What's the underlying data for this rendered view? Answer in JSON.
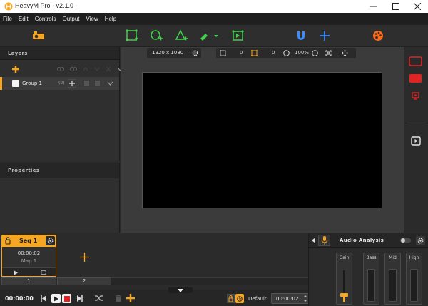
{
  "window": {
    "title": "HeavyM Pro - v2.1.0 -",
    "accent": "#f5a623"
  },
  "menu": [
    "File",
    "Edit",
    "Controls",
    "Output",
    "View",
    "Help"
  ],
  "toolbar": {
    "icons": [
      "settings-heavym-icon",
      "rectangle-shape-icon",
      "circle-shape-icon",
      "triangle-shape-icon",
      "paint-brush-icon",
      "duplicate-shape-icon",
      "magnet-icon",
      "crosshair-icon",
      "palette-icon"
    ],
    "colors": {
      "shape": "#41d14a",
      "magnet": "#3a8cff",
      "palette": "#ff6a1a"
    }
  },
  "layers": {
    "header": "Layers",
    "group": {
      "name": "Group 1",
      "count": "(0)"
    }
  },
  "properties": {
    "header": "Properties"
  },
  "canvas": {
    "resolution": "1920 x 1080",
    "field_a": "0",
    "field_b": "0",
    "zoom": "100%"
  },
  "sequence": {
    "seq_name": "Seq 1",
    "time": "00:00:02",
    "map_name": "Map 1",
    "slot_numbers": [
      "1",
      "2"
    ],
    "add_symbol": "+"
  },
  "transport": {
    "time": "00:00:00",
    "default_label": "Default:",
    "default_value": "00:00:02"
  },
  "audio": {
    "title": "Audio Analysis",
    "channels": [
      "Gain",
      "Bass",
      "Mid",
      "High"
    ],
    "gain_level": 0.25
  }
}
